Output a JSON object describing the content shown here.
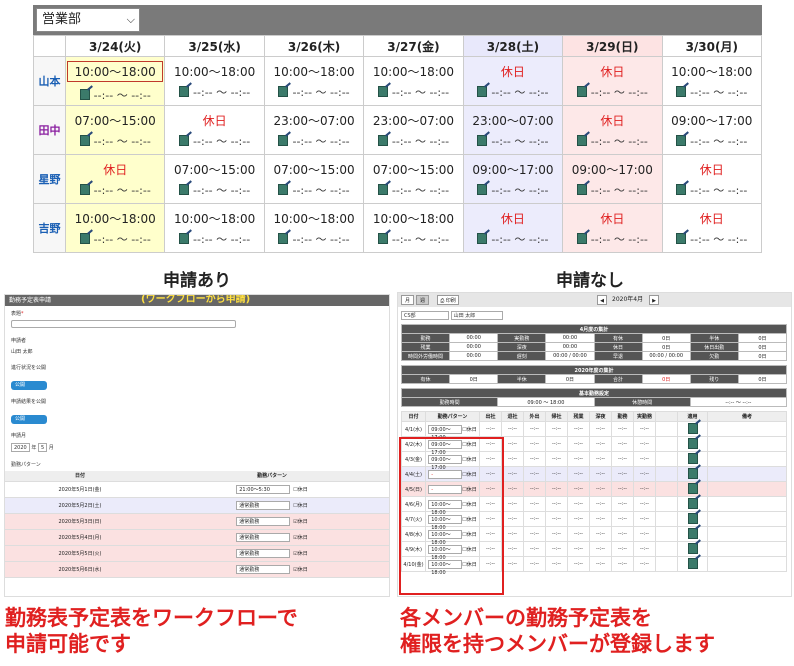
{
  "top": {
    "department": "営業部",
    "dates": [
      {
        "label": "3/24(火)",
        "kind": "today"
      },
      {
        "label": "3/25(水)",
        "kind": "weekday"
      },
      {
        "label": "3/26(木)",
        "kind": "weekday"
      },
      {
        "label": "3/27(金)",
        "kind": "weekday"
      },
      {
        "label": "3/28(土)",
        "kind": "sat"
      },
      {
        "label": "3/29(日)",
        "kind": "sun"
      },
      {
        "label": "3/30(月)",
        "kind": "weekday"
      }
    ],
    "record_placeholder": "--:-- ～ --:--",
    "rows": [
      {
        "name": "山本",
        "color": "#1a5fb4",
        "shifts": [
          "10:00～18:00",
          "10:00～18:00",
          "10:00～18:00",
          "10:00～18:00",
          "休日",
          "休日",
          "10:00～18:00"
        ]
      },
      {
        "name": "田中",
        "color": "#8a1fa0",
        "shifts": [
          "07:00～15:00",
          "休日",
          "23:00～07:00",
          "23:00～07:00",
          "23:00～07:00",
          "休日",
          "09:00～17:00"
        ]
      },
      {
        "name": "星野",
        "color": "#1a5fb4",
        "shifts": [
          "休日",
          "07:00～15:00",
          "07:00～15:00",
          "07:00～15:00",
          "09:00～17:00",
          "09:00～17:00",
          "休日"
        ]
      },
      {
        "name": "吉野",
        "color": "#1a5fb4",
        "shifts": [
          "10:00～18:00",
          "10:00～18:00",
          "10:00～18:00",
          "10:00～18:00",
          "休日",
          "休日",
          "休日"
        ]
      }
    ]
  },
  "labels": {
    "with_request": "申請あり",
    "without_request": "申請なし"
  },
  "left": {
    "title": "勤務予定表申請",
    "workflow_note": "(ワークフローから申請)",
    "subject_label": "表題",
    "applicant_label": "申請者",
    "applicant_value": "山田 太郎",
    "progress_label": "進行状況を公開",
    "result_label": "申請結果を公開",
    "toggle_value": "公開",
    "month_label": "申請月",
    "year_value": "2020",
    "year_unit": "年",
    "month_value": "5",
    "month_unit": "月",
    "pattern_label": "勤務パターン",
    "col_date": "日付",
    "col_pattern": "勤務パターン",
    "holiday_label": "休日",
    "rows": [
      {
        "date": "2020年5月1日(金)",
        "pattern": "21:00〜5:30",
        "kind": "weekday",
        "holiday": false
      },
      {
        "date": "2020年5月2日(土)",
        "pattern": "通常勤務",
        "kind": "sat",
        "holiday": false
      },
      {
        "date": "2020年5月3日(日)",
        "pattern": "通常勤務",
        "kind": "sun",
        "holiday": true
      },
      {
        "date": "2020年5月4日(月)",
        "pattern": "通常勤務",
        "kind": "sun",
        "holiday": true
      },
      {
        "date": "2020年5月5日(火)",
        "pattern": "通常勤務",
        "kind": "sun",
        "holiday": true
      },
      {
        "date": "2020年5月6日(水)",
        "pattern": "通常勤務",
        "kind": "sun",
        "holiday": true
      }
    ]
  },
  "right": {
    "tab_month": "月",
    "tab_week": "週",
    "print": "印刷",
    "period": "2020年4月",
    "dept": "CS部",
    "person": "山田 太郎",
    "month_total_title": "4月度の集計",
    "month_total_rows": [
      [
        "勤務",
        "00:00",
        "実勤務",
        "00:00",
        "有休",
        "0日",
        "半休",
        "0日"
      ],
      [
        "残業",
        "00:00",
        "深夜",
        "00:00",
        "休日",
        "0日",
        "休日出勤",
        "0日"
      ],
      [
        "時間外労働時間",
        "00:00",
        "遅刻",
        "00:00 / 00:00",
        "早退",
        "00:00 / 00:00",
        "欠勤",
        "0日"
      ]
    ],
    "year_total_title": "2020年度の集計",
    "year_total_row": [
      "有休",
      "0日",
      "半休",
      "0日",
      "合計",
      "0日",
      "残り",
      "0日"
    ],
    "basic_title": "基本勤務設定",
    "basic_row": [
      "勤務時間",
      "09:00 ～ 18:00",
      "休憩時間",
      "--:-- ～ --:--"
    ],
    "cols": [
      "日付",
      "勤務パターン",
      "出社",
      "退社",
      "外出",
      "帰社",
      "残業",
      "深夜",
      "勤務",
      "実勤務",
      "",
      "適用",
      "備考"
    ],
    "dash": "--:--",
    "holiday_label": "休日",
    "rows": [
      {
        "date": "4/1(水)",
        "pattern": "09:00〜17:00",
        "kind": "weekday"
      },
      {
        "date": "4/2(木)",
        "pattern": "09:00〜17:00",
        "kind": "weekday"
      },
      {
        "date": "4/3(金)",
        "pattern": "09:00〜17:00",
        "kind": "weekday"
      },
      {
        "date": "4/4(土)",
        "pattern": "-",
        "kind": "sat"
      },
      {
        "date": "4/5(日)",
        "pattern": "-",
        "kind": "sun"
      },
      {
        "date": "4/6(月)",
        "pattern": "10:00〜18:00",
        "kind": "weekday"
      },
      {
        "date": "4/7(火)",
        "pattern": "10:00〜18:00",
        "kind": "weekday"
      },
      {
        "date": "4/8(水)",
        "pattern": "10:00〜18:00",
        "kind": "weekday"
      },
      {
        "date": "4/9(木)",
        "pattern": "10:00〜18:00",
        "kind": "weekday"
      },
      {
        "date": "4/10(金)",
        "pattern": "10:00〜18:00",
        "kind": "weekday"
      }
    ]
  },
  "captions": {
    "left_line1": "勤務表予定表をワークフローで",
    "left_line2": "申請可能です",
    "right_line1": "各メンバーの勤務予定表を",
    "right_line2": "権限を持つメンバーが登録します"
  }
}
